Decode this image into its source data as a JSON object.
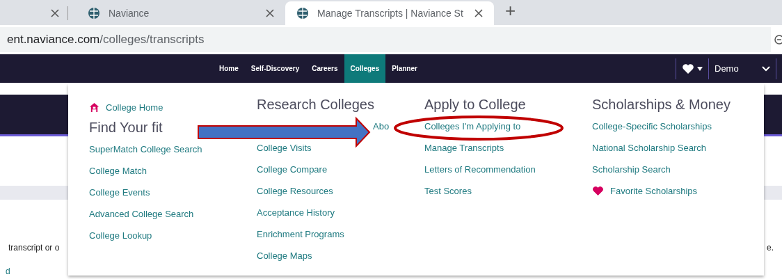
{
  "browser": {
    "tabs": [
      {
        "title": "Naviance",
        "selected": false
      },
      {
        "title": "Manage Transcripts | Naviance St",
        "selected": true
      }
    ],
    "new_tab": "+",
    "url_host": "ent.naviance.com",
    "url_path": "/colleges/transcripts"
  },
  "nav": {
    "items": [
      {
        "label": "Home",
        "selected": false
      },
      {
        "label": "Self-Discovery",
        "selected": false
      },
      {
        "label": "Careers",
        "selected": false
      },
      {
        "label": "Colleges",
        "selected": true
      },
      {
        "label": "Planner",
        "selected": false
      }
    ],
    "user": "Demo"
  },
  "menu": {
    "columns": [
      {
        "items": [
          {
            "kind": "home",
            "label": "College Home"
          },
          {
            "kind": "heading",
            "label": "Find Your fit"
          },
          {
            "kind": "link",
            "label": "SuperMatch College Search"
          },
          {
            "kind": "link",
            "label": "College Match"
          },
          {
            "kind": "link",
            "label": "College Events"
          },
          {
            "kind": "link",
            "label": "Advanced College Search"
          },
          {
            "kind": "link",
            "label": "College Lookup"
          }
        ]
      },
      {
        "items": [
          {
            "kind": "heading",
            "label": "Research Colleges"
          },
          {
            "kind": "covered",
            "label": "Abo"
          },
          {
            "kind": "link",
            "label": "College Visits"
          },
          {
            "kind": "link",
            "label": "College Compare"
          },
          {
            "kind": "link",
            "label": "College Resources"
          },
          {
            "kind": "link",
            "label": "Acceptance History"
          },
          {
            "kind": "link",
            "label": "Enrichment Programs"
          },
          {
            "kind": "link",
            "label": "College Maps"
          }
        ]
      },
      {
        "items": [
          {
            "kind": "heading",
            "label": "Apply to College"
          },
          {
            "kind": "link",
            "label": "Colleges I'm Applying to"
          },
          {
            "kind": "link",
            "label": "Manage Transcripts"
          },
          {
            "kind": "link",
            "label": "Letters of Recommendation"
          },
          {
            "kind": "link",
            "label": "Test Scores"
          }
        ]
      },
      {
        "items": [
          {
            "kind": "heading",
            "label": "Scholarships & Money"
          },
          {
            "kind": "link",
            "label": "College-Specific Scholarships"
          },
          {
            "kind": "link",
            "label": "National Scholarship Search"
          },
          {
            "kind": "link",
            "label": "Scholarship Search"
          },
          {
            "kind": "heart",
            "label": "Favorite Scholarships"
          }
        ]
      }
    ]
  },
  "page": {
    "text_left": "transcript or o",
    "text_right": "e.",
    "link_fragment": "d"
  }
}
